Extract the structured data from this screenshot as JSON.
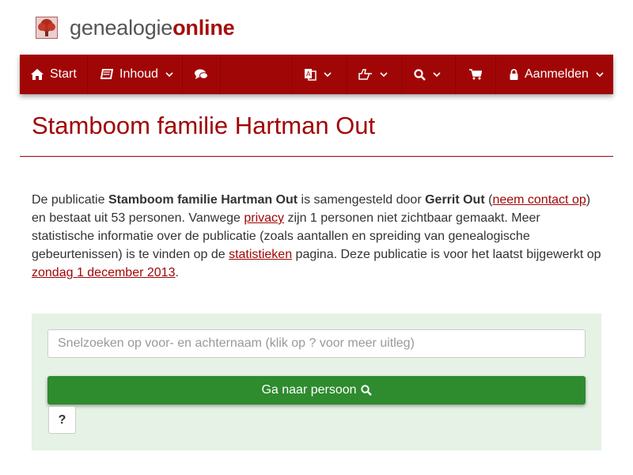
{
  "logo": {
    "text_part1": "genealogie",
    "text_part2": "online",
    "icon": "tree-icon"
  },
  "nav": {
    "start": {
      "label": "Start",
      "icon": "home-icon"
    },
    "inhoud": {
      "label": "Inhoud",
      "icon": "book-icon"
    },
    "chat": {
      "icon": "comments-icon"
    },
    "language": {
      "icon": "language-icon"
    },
    "share": {
      "icon": "share-icon"
    },
    "search": {
      "icon": "search-icon"
    },
    "cart": {
      "icon": "cart-icon"
    },
    "login": {
      "label": "Aanmelden",
      "icon": "lock-icon"
    }
  },
  "page_title": "Stamboom familie Hartman Out",
  "intro": {
    "t1": "De publicatie ",
    "pub_name": "Stamboom familie Hartman Out",
    "t2": " is samengesteld door ",
    "author": "Gerrit Out",
    "t3": " (",
    "contact_link": "neem contact op",
    "t4": ") en bestaat uit 53 personen. Vanwege ",
    "privacy_link": "privacy",
    "t5": " zijn 1 personen niet zichtbaar gemaakt. Meer statistische informatie over de publicatie (zoals aantallen en spreiding van genealogische gebeurtenissen) is te vinden op de ",
    "stats_link": "statistieken",
    "t6": " pagina. Deze publicatie is voor het laatst bijgewerkt op ",
    "date_link": "zondag 1 december 2013",
    "t7": "."
  },
  "search": {
    "placeholder": "Snelzoeken op voor- en achternaam (klik op ? voor meer uitleg)",
    "value": "",
    "go_label": "Ga naar persoon",
    "help_label": "?"
  },
  "colors": {
    "brand": "#a10606",
    "navbar": "#a10606",
    "button_green": "#2e8b2e",
    "panel_bg": "#e5f2e5"
  }
}
